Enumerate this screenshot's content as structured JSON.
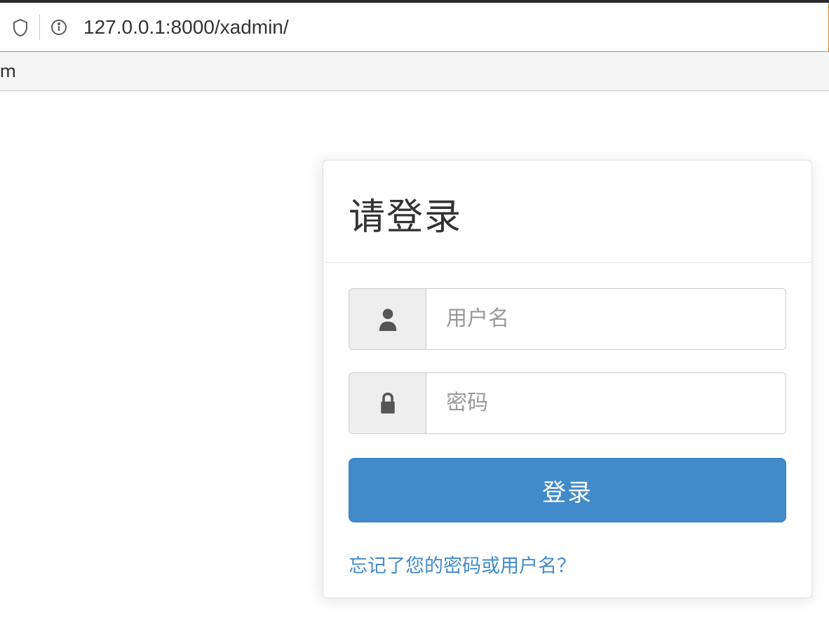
{
  "browser": {
    "url": "127.0.0.1:8000/xadmin/",
    "bookmark_fragment": "m"
  },
  "login": {
    "title": "请登录",
    "username_placeholder": "用户名",
    "password_placeholder": "密码",
    "submit_label": "登录",
    "forgot_label": "忘记了您的密码或用户名？"
  },
  "colors": {
    "primary": "#428bca",
    "border": "#cccccc",
    "addon_bg": "#eeeeee"
  }
}
